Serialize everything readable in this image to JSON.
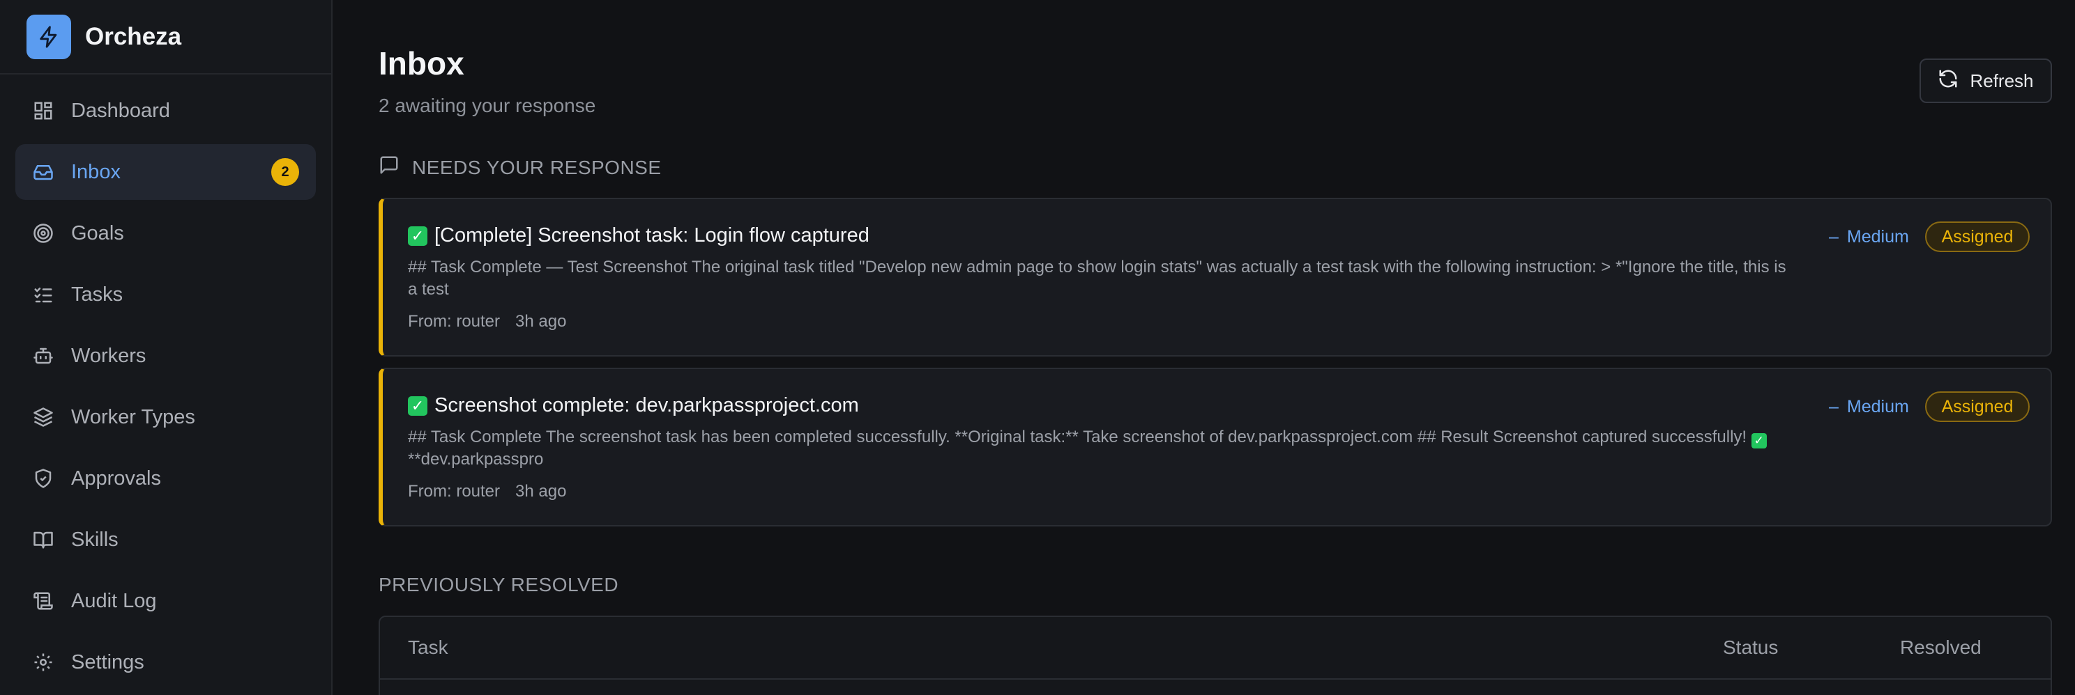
{
  "brand": {
    "name": "Orcheza"
  },
  "sidebar": {
    "items": [
      {
        "label": "Dashboard",
        "icon": "dashboard-icon"
      },
      {
        "label": "Inbox",
        "icon": "inbox-icon",
        "badge": "2",
        "active": true
      },
      {
        "label": "Goals",
        "icon": "target-icon"
      },
      {
        "label": "Tasks",
        "icon": "list-checks-icon"
      },
      {
        "label": "Workers",
        "icon": "bot-icon"
      },
      {
        "label": "Worker Types",
        "icon": "layers-icon"
      },
      {
        "label": "Approvals",
        "icon": "shield-check-icon"
      },
      {
        "label": "Skills",
        "icon": "book-open-icon"
      },
      {
        "label": "Audit Log",
        "icon": "scroll-icon"
      },
      {
        "label": "Settings",
        "icon": "gear-icon"
      }
    ]
  },
  "header": {
    "title": "Inbox",
    "subtitle": "2 awaiting your response",
    "refresh_label": "Refresh"
  },
  "needs_response": {
    "heading": "NEEDS YOUR RESPONSE",
    "cards": [
      {
        "title": "[Complete] Screenshot task: Login flow captured",
        "body": "## Task Complete — Test Screenshot The original task titled \"Develop new admin page to show login stats\" was actually a test task with the following instruction: > *\"Ignore the title, this is a test",
        "from": "From: router",
        "time": "3h ago",
        "priority": "Medium",
        "status": "Assigned"
      },
      {
        "title": "Screenshot complete: dev.parkpassproject.com",
        "body_start": "## Task Complete The screenshot task has been completed successfully. **Original task:** Take screenshot of dev.parkpassproject.com ## Result Screenshot captured successfully!",
        "body_end": "**dev.parkpasspro",
        "from": "From: router",
        "time": "3h ago",
        "priority": "Medium",
        "status": "Assigned"
      }
    ]
  },
  "resolved": {
    "heading": "PREVIOUSLY RESOLVED",
    "columns": [
      "Task",
      "Status",
      "Resolved"
    ]
  },
  "colors": {
    "accent": "#6aa6f2",
    "badge": "#eab308",
    "card_border": "#eab308",
    "check": "#22c55e"
  }
}
